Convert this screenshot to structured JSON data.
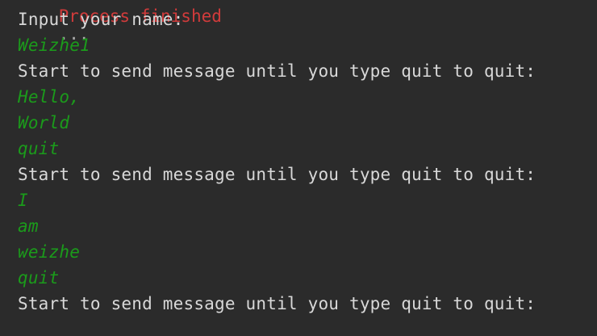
{
  "console": {
    "cut_off_line": {
      "red": "Process finished",
      "gray": "..."
    },
    "lines": [
      {
        "kind": "output",
        "text": "Input your name:"
      },
      {
        "kind": "input",
        "text": "Weizhe1"
      },
      {
        "kind": "output",
        "text": "Start to send message until you type quit to quit:"
      },
      {
        "kind": "input",
        "text": "Hello,"
      },
      {
        "kind": "input",
        "text": "World"
      },
      {
        "kind": "input",
        "text": "quit"
      },
      {
        "kind": "output",
        "text": "Start to send message until you type quit to quit:"
      },
      {
        "kind": "input",
        "text": "I"
      },
      {
        "kind": "input",
        "text": "am"
      },
      {
        "kind": "input",
        "text": "weizhe"
      },
      {
        "kind": "input",
        "text": "quit"
      },
      {
        "kind": "output",
        "text": "Start to send message until you type quit to quit:"
      }
    ]
  }
}
